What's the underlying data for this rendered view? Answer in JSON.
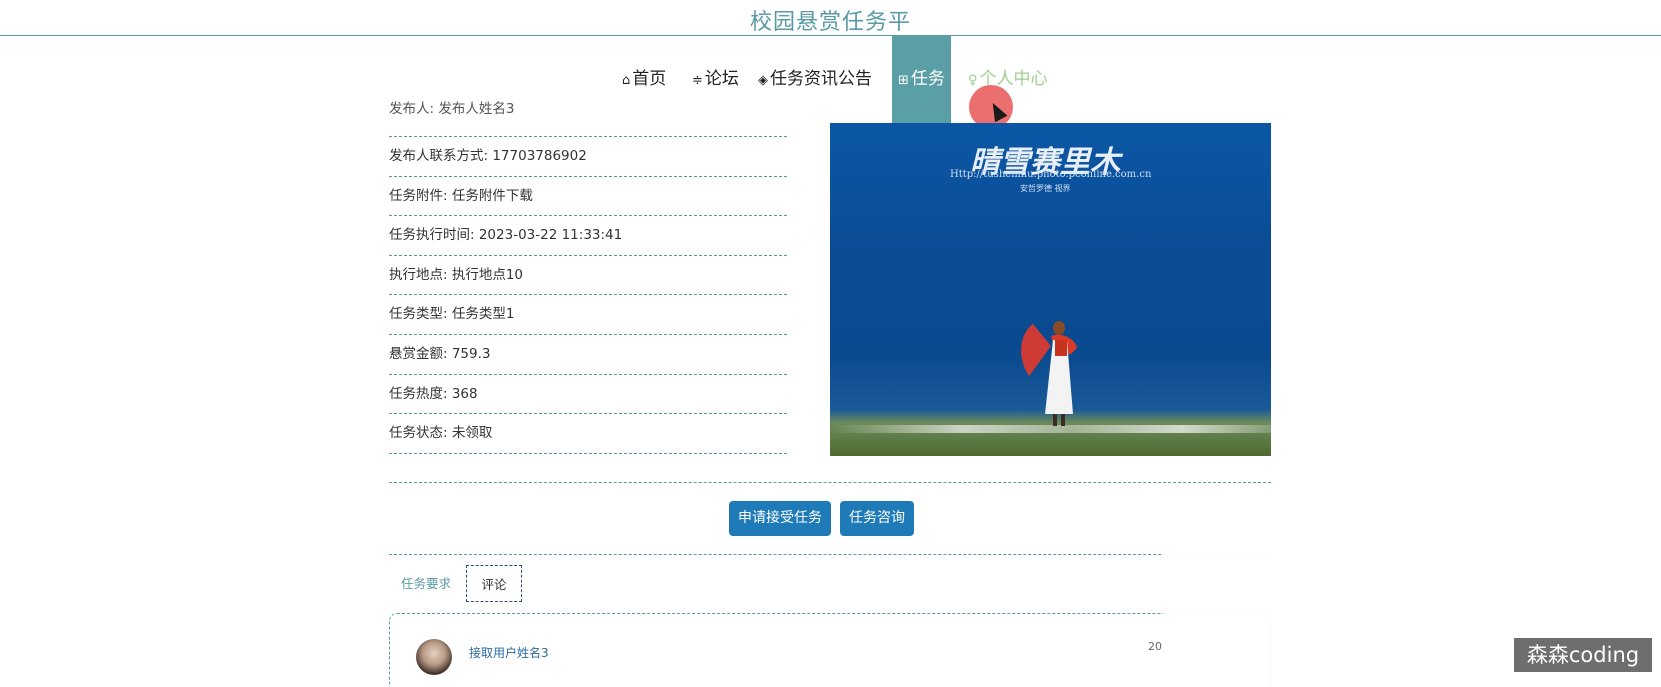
{
  "header": {
    "title": "校园悬赏任务平"
  },
  "nav": {
    "items": [
      {
        "icon": "home-icon",
        "glyph": "⌂",
        "label": "首页"
      },
      {
        "icon": "sliders-icon",
        "glyph": "≑",
        "label": "论坛"
      },
      {
        "icon": "layers-icon",
        "glyph": "◈",
        "label": "任务资讯公告"
      },
      {
        "icon": "gift-icon",
        "glyph": "⊞",
        "label": "任务"
      },
      {
        "icon": "user-icon",
        "glyph": "♀",
        "label": "个人中心"
      }
    ]
  },
  "task": {
    "cut_row": "发布人: 发布人姓名3",
    "publisher_contact": "发布人联系方式: 17703786902",
    "attachment": "任务附件: 任务附件下载",
    "exec_time": "任务执行时间: 2023-03-22 11:33:41",
    "location": "执行地点: 执行地点10",
    "type": "任务类型: 任务类型1",
    "reward": "悬赏金额: 759.3",
    "heat": "任务热度: 368",
    "status": "任务状态: 未领取"
  },
  "image": {
    "watermark_title": "晴雪赛里木",
    "watermark_url": "Http://tushenmu.photo.pconline.com.cn",
    "watermark_credit": "安哲罗德 视界"
  },
  "actions": {
    "apply_label": "申请接受任务",
    "consult_label": "任务咨询"
  },
  "tabs": [
    {
      "label": "任务要求"
    },
    {
      "label": "评论"
    }
  ],
  "comment": {
    "user": "接取用户姓名3",
    "date": "20"
  },
  "overlay": {
    "watermark": "森森coding"
  },
  "colors": {
    "accent": "#5a9aa5",
    "button": "#1f7bb8",
    "nav_active": "#5a9fa6",
    "nav_hover": "#9ecf8f"
  }
}
